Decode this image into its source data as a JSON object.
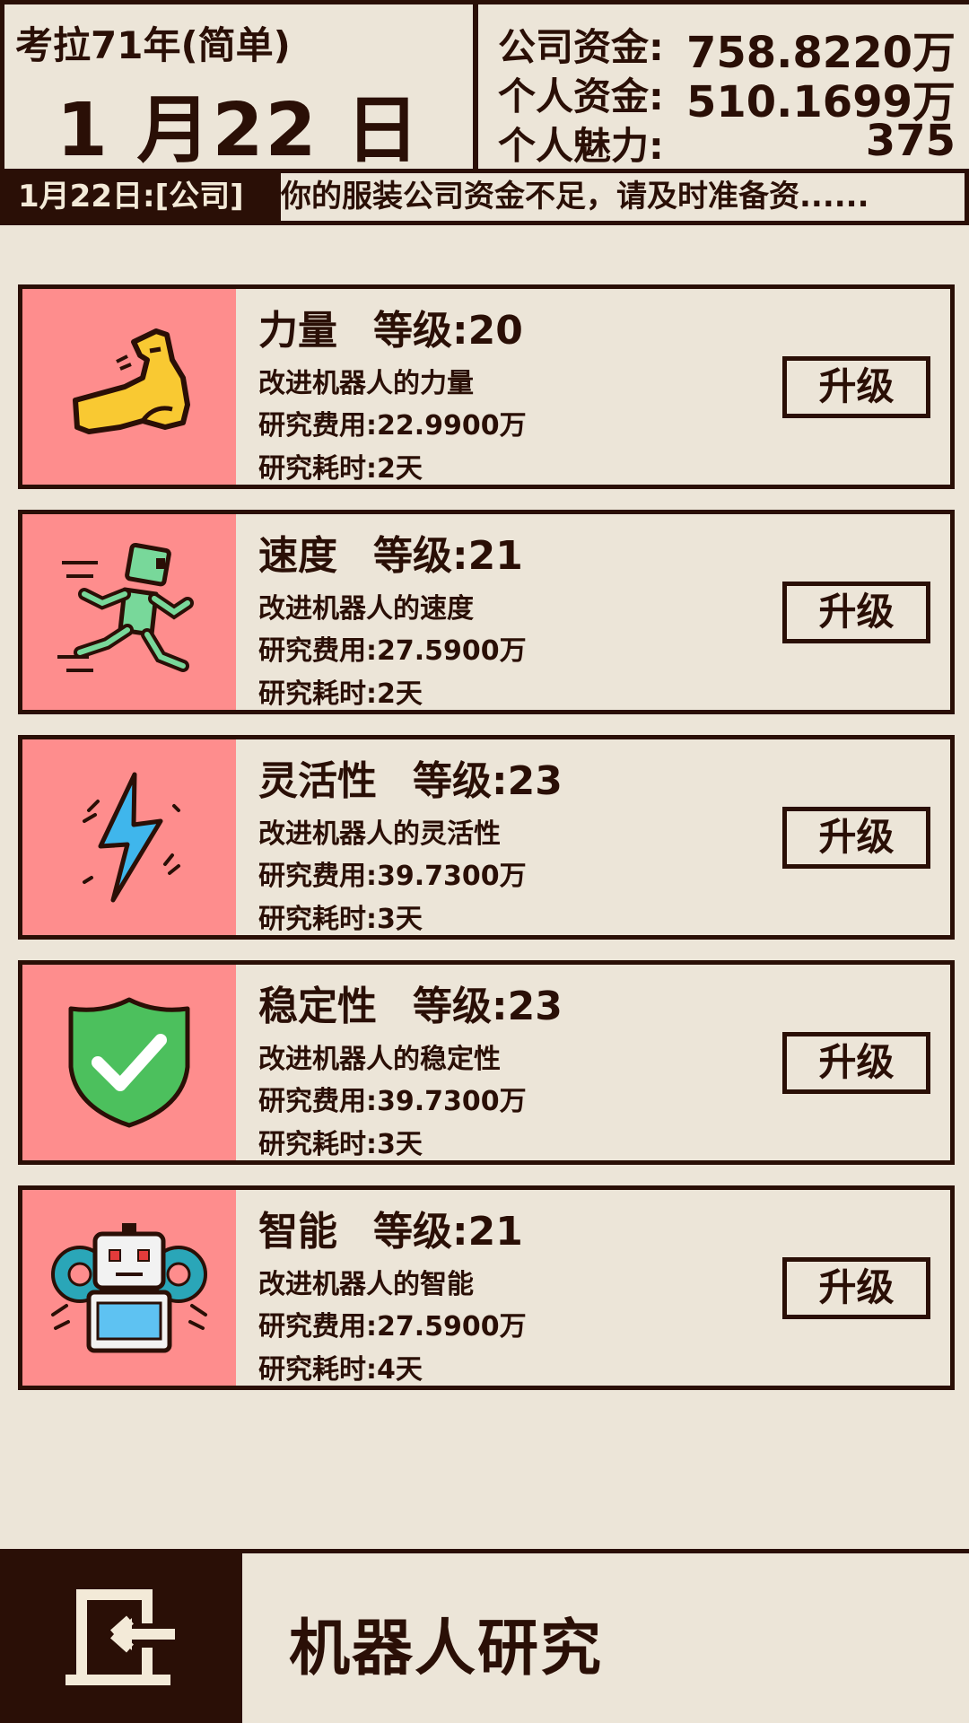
{
  "header": {
    "era": "考拉71年(简单)",
    "date": "1 月22 日",
    "company_funds_label": "公司资金:",
    "company_funds_value": "758.8220万",
    "personal_funds_label": "个人资金:",
    "personal_funds_value": "510.1699万",
    "charm_label": "个人魅力:",
    "charm_value": "375"
  },
  "ticker": {
    "date_tag": "1月22日:[公司]",
    "message": "你的服装公司资金不足，请及时准备资......"
  },
  "research": [
    {
      "name": "力量",
      "level": "等级:20",
      "desc": "改进机器人的力量",
      "cost": "研究费用:22.9900万",
      "duration": "研究耗时:2天",
      "button": "升级",
      "icon": "flexed-arm-icon"
    },
    {
      "name": "速度",
      "level": "等级:21",
      "desc": "改进机器人的速度",
      "cost": "研究费用:27.5900万",
      "duration": "研究耗时:2天",
      "button": "升级",
      "icon": "running-robot-icon"
    },
    {
      "name": "灵活性",
      "level": "等级:23",
      "desc": "改进机器人的灵活性",
      "cost": "研究费用:39.7300万",
      "duration": "研究耗时:3天",
      "button": "升级",
      "icon": "lightning-bolt-icon"
    },
    {
      "name": "稳定性",
      "level": "等级:23",
      "desc": "改进机器人的稳定性",
      "cost": "研究费用:39.7300万",
      "duration": "研究耗时:3天",
      "button": "升级",
      "icon": "shield-check-icon"
    },
    {
      "name": "智能",
      "level": "等级:21",
      "desc": "改进机器人的智能",
      "cost": "研究费用:27.5900万",
      "duration": "研究耗时:4天",
      "button": "升级",
      "icon": "robot-gear-icon"
    }
  ],
  "bottom": {
    "page_title": "机器人研究",
    "back_icon": "exit-door-icon"
  },
  "colors": {
    "background": "#ece5d8",
    "dark": "#2a0f06",
    "icon_pane": "#fe8d8d"
  }
}
